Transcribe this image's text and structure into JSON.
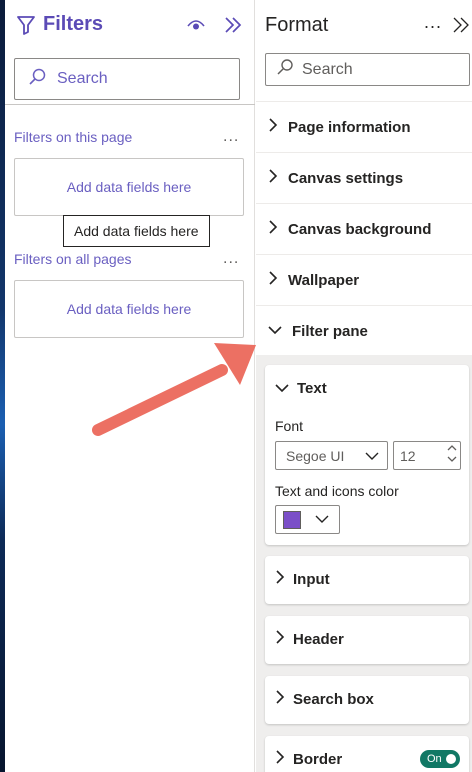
{
  "filters_pane": {
    "title": "Filters",
    "search_placeholder": "Search",
    "sections": [
      {
        "label": "Filters on this page",
        "more": "...",
        "drop_zone": "Add data fields here"
      },
      {
        "label": "Filters on all pages",
        "more": "...",
        "drop_zone": "Add data fields here"
      }
    ],
    "tooltip": "Add data fields here"
  },
  "format_pane": {
    "title": "Format",
    "more": "...",
    "search_placeholder": "Search",
    "rows": [
      {
        "label": "Page information"
      },
      {
        "label": "Canvas settings"
      },
      {
        "label": "Canvas background"
      },
      {
        "label": "Wallpaper"
      },
      {
        "label": "Filter pane",
        "expanded": true
      }
    ],
    "filter_pane": {
      "text_card": {
        "label": "Text",
        "font_label": "Font",
        "font_value": "Segoe UI",
        "size_value": "12",
        "color_label": "Text and icons color",
        "color_value": "#7b4fc8"
      },
      "cards": [
        {
          "label": "Input"
        },
        {
          "label": "Header"
        },
        {
          "label": "Search box"
        },
        {
          "label": "Border",
          "toggle": "On"
        }
      ]
    }
  },
  "colors": {
    "accent_purple": "#6a5fc1",
    "toggle_green": "#117865",
    "annotation_arrow": "#ec7063"
  },
  "icons": [
    "filter-icon",
    "eye-icon",
    "double-chevron-right-icon",
    "search-icon",
    "more-icon",
    "chevron-right-icon",
    "chevron-down-icon",
    "stepper-up-icon",
    "stepper-down-icon"
  ]
}
